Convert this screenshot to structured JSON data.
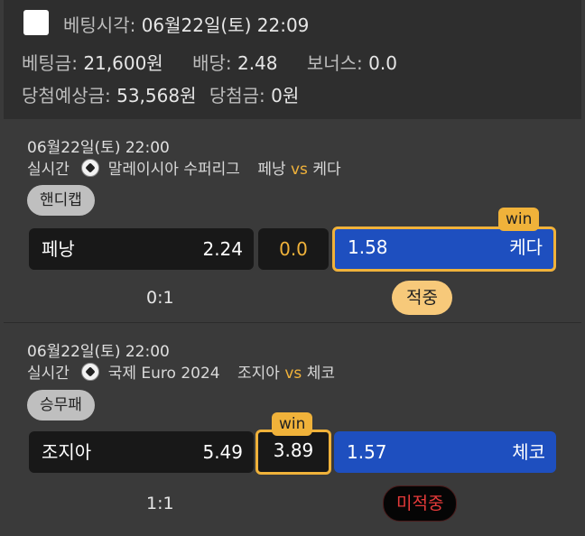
{
  "header": {
    "bet_time_label": "베팅시각:",
    "bet_time": "06월22일(토) 22:09",
    "bet_amount_label": "베팅금:",
    "bet_amount": "21,600원",
    "odds_label": "배당:",
    "odds": "2.48",
    "bonus_label": "보너스:",
    "bonus": "0.0",
    "expected_label": "당첨예상금:",
    "expected": "53,568원",
    "won_label": "당첨금:",
    "won": "0원"
  },
  "games": [
    {
      "datetime": "06월22일(토) 22:00",
      "live": "실시간",
      "league": "말레이시아 수퍼리그",
      "home": "페낭",
      "vs": "vs",
      "away": "케다",
      "market": "핸디캡",
      "home_team": "페낭",
      "home_odds": "2.24",
      "middle": "0.0",
      "away_odds": "1.58",
      "away_team": "케다",
      "win_badge": "win",
      "score": "0:1",
      "result": "적중"
    },
    {
      "datetime": "06월22일(토) 22:00",
      "live": "실시간",
      "league": "국제 Euro 2024",
      "home": "조지아",
      "vs": "vs",
      "away": "체코",
      "market": "승무패",
      "home_team": "조지아",
      "home_odds": "5.49",
      "middle": "3.89",
      "away_odds": "1.57",
      "away_team": "체코",
      "win_badge": "win",
      "score": "1:1",
      "result": "미적중"
    }
  ],
  "colors": {
    "accent_gold": "#f0b23a",
    "selected_blue": "#1e4fbf",
    "lose_red": "#e53a3a"
  }
}
